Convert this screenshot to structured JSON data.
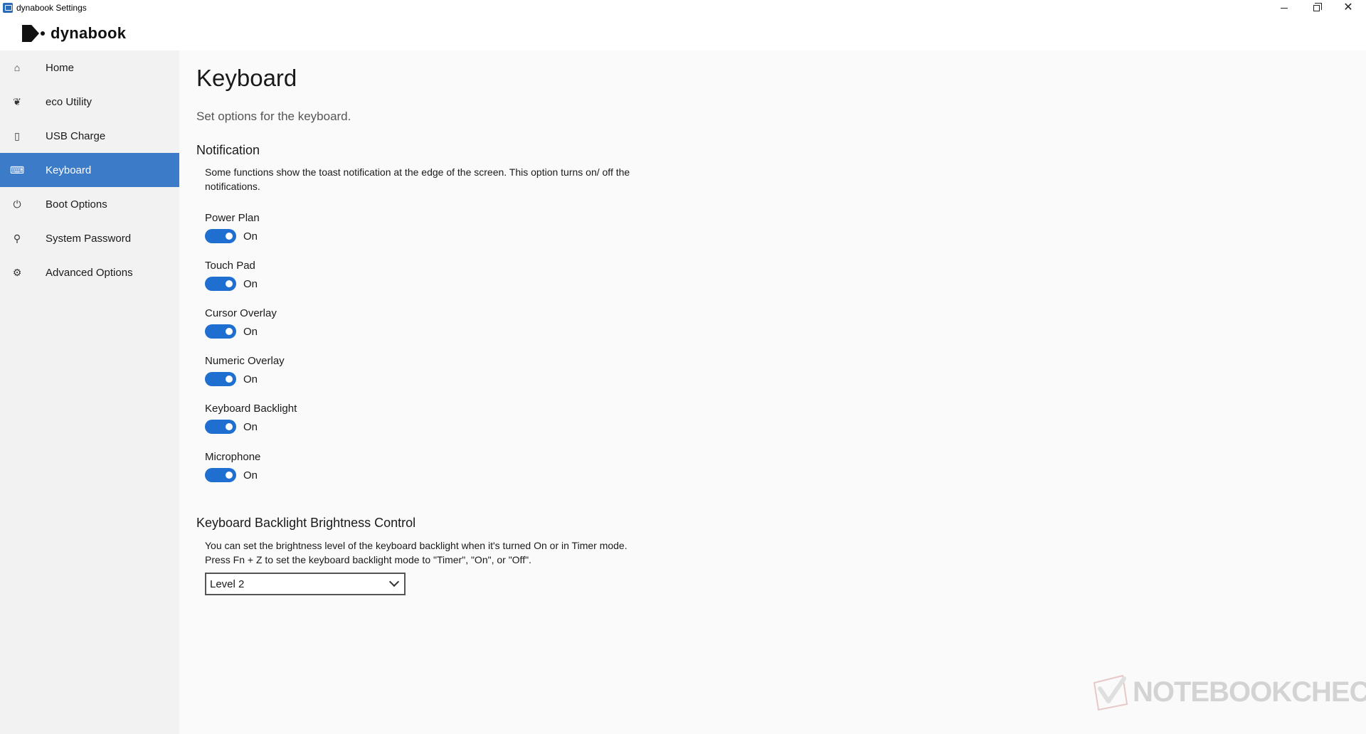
{
  "window": {
    "title": "dynabook Settings",
    "minimize_icon": "minimize-icon",
    "maximize_icon": "restore-icon",
    "close_icon": "close-icon",
    "close_glyph": "✕"
  },
  "logo": {
    "text": "dynabook"
  },
  "sidebar": {
    "items": [
      {
        "label": "Home",
        "icon": "home-icon",
        "glyph": "⌂",
        "active": false
      },
      {
        "label": "eco Utility",
        "icon": "leaf-icon",
        "glyph": "❦",
        "active": false
      },
      {
        "label": "USB Charge",
        "icon": "usb-icon",
        "glyph": "▯",
        "active": false
      },
      {
        "label": "Keyboard",
        "icon": "keyboard-icon",
        "glyph": "⌨",
        "active": true
      },
      {
        "label": "Boot Options",
        "icon": "power-icon",
        "glyph": "⏻",
        "active": false
      },
      {
        "label": "System Password",
        "icon": "key-icon",
        "glyph": "⚲",
        "active": false
      },
      {
        "label": "Advanced Options",
        "icon": "gear-icon",
        "glyph": "⚙",
        "active": false
      }
    ]
  },
  "main": {
    "title": "Keyboard",
    "subtitle": "Set options for the keyboard.",
    "notification": {
      "title": "Notification",
      "description": "Some functions show the toast notification at the edge of the screen. This option turns on/ off the notifications.",
      "toggles": [
        {
          "label": "Power Plan",
          "state": "On",
          "on": true
        },
        {
          "label": "Touch Pad",
          "state": "On",
          "on": true
        },
        {
          "label": "Cursor Overlay",
          "state": "On",
          "on": true
        },
        {
          "label": "Numeric Overlay",
          "state": "On",
          "on": true
        },
        {
          "label": "Keyboard Backlight",
          "state": "On",
          "on": true
        },
        {
          "label": "Microphone",
          "state": "On",
          "on": true
        }
      ]
    },
    "backlight": {
      "title": "Keyboard Backlight Brightness Control",
      "description": "You can set the brightness level of the keyboard backlight when it's turned On or in Timer mode. Press Fn + Z to set the keyboard backlight mode to \"Timer\", \"On\", or \"Off\".",
      "selected": "Level 2"
    }
  },
  "watermark": {
    "text": "NOTEBOOKCHECK"
  },
  "colors": {
    "accent": "#3b7bc8",
    "toggle_on": "#1f6fd1",
    "sidebar_bg": "#f2f2f2",
    "main_bg": "#fafafa"
  }
}
